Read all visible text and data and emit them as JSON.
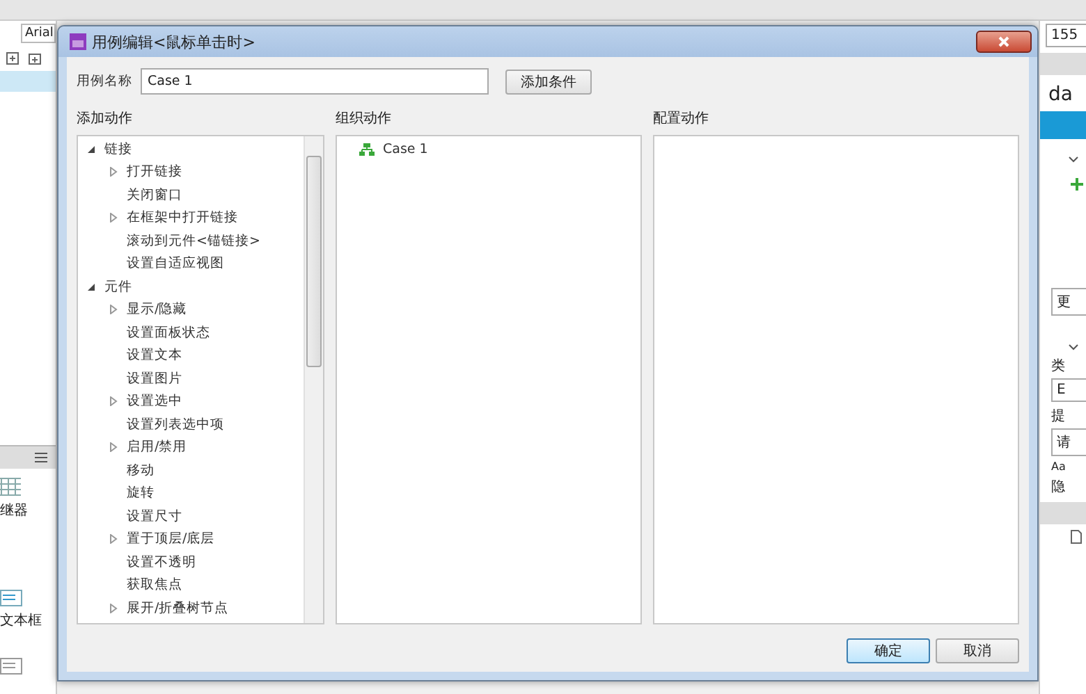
{
  "background": {
    "font_field": "Arial",
    "left_labels": [
      "继器",
      "文本框"
    ],
    "right": {
      "number_field": "155",
      "name": "da",
      "button": "更",
      "label_1": "类",
      "field_1": "E",
      "label_2": "提",
      "field_2": "请",
      "style_label": "Aa",
      "label_3": "隐"
    }
  },
  "dialog": {
    "title": "用例编辑<鼠标单击时>",
    "name_label": "用例名称",
    "name_value": "Case 1",
    "add_condition": "添加条件",
    "columns": [
      "添加动作",
      "组织动作",
      "配置动作"
    ],
    "actions": [
      {
        "label": "链接",
        "expanded": true,
        "children": [
          {
            "label": "打开链接",
            "expanded": false
          },
          {
            "label": "关闭窗口"
          },
          {
            "label": "在框架中打开链接",
            "expanded": false
          },
          {
            "label": "滚动到元件<锚链接>"
          },
          {
            "label": "设置自适应视图"
          }
        ]
      },
      {
        "label": "元件",
        "expanded": true,
        "children": [
          {
            "label": "显示/隐藏",
            "expanded": false
          },
          {
            "label": "设置面板状态"
          },
          {
            "label": "设置文本"
          },
          {
            "label": "设置图片"
          },
          {
            "label": "设置选中",
            "expanded": false
          },
          {
            "label": "设置列表选中项"
          },
          {
            "label": "启用/禁用",
            "expanded": false
          },
          {
            "label": "移动"
          },
          {
            "label": "旋转"
          },
          {
            "label": "设置尺寸"
          },
          {
            "label": "置于顶层/底层",
            "expanded": false
          },
          {
            "label": "设置不透明"
          },
          {
            "label": "获取焦点"
          },
          {
            "label": "展开/折叠树节点",
            "expanded": false
          }
        ]
      }
    ],
    "cases": [
      "Case 1"
    ],
    "buttons": [
      "确定",
      "取消"
    ]
  }
}
